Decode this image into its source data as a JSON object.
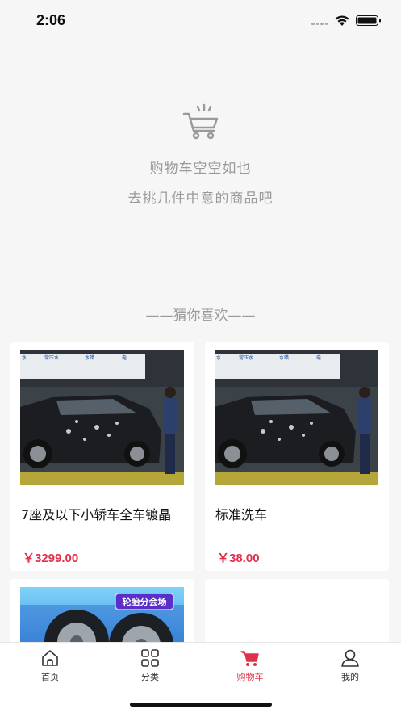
{
  "status_bar": {
    "time": "2:06"
  },
  "empty_cart": {
    "icon": "shopping-cart-icon",
    "message_line1": "购物车空空如也",
    "message_line2": "去挑几件中意的商品吧"
  },
  "recommend": {
    "title": "——猜你喜欢——",
    "products": [
      {
        "name": "7座及以下小轿车全车镀晶",
        "price": "￥3299.00",
        "image": "car-wash-photo"
      },
      {
        "name": "标准洗车",
        "price": "￥38.00",
        "image": "car-wash-photo"
      },
      {
        "name": "",
        "price": "",
        "image": "tire-promo-photo",
        "image_badge": "轮胎分会场"
      },
      {
        "name": "",
        "price": "",
        "image": ""
      }
    ]
  },
  "tab_bar": {
    "items": [
      {
        "label": "首页",
        "icon": "home-icon",
        "active": false
      },
      {
        "label": "分类",
        "icon": "grid-icon",
        "active": false
      },
      {
        "label": "购物车",
        "icon": "cart-icon",
        "active": true
      },
      {
        "label": "我的",
        "icon": "user-icon",
        "active": false
      }
    ]
  },
  "colors": {
    "accent": "#e0314a",
    "background": "#f6f6f6",
    "muted_text": "#9a9a9a"
  }
}
